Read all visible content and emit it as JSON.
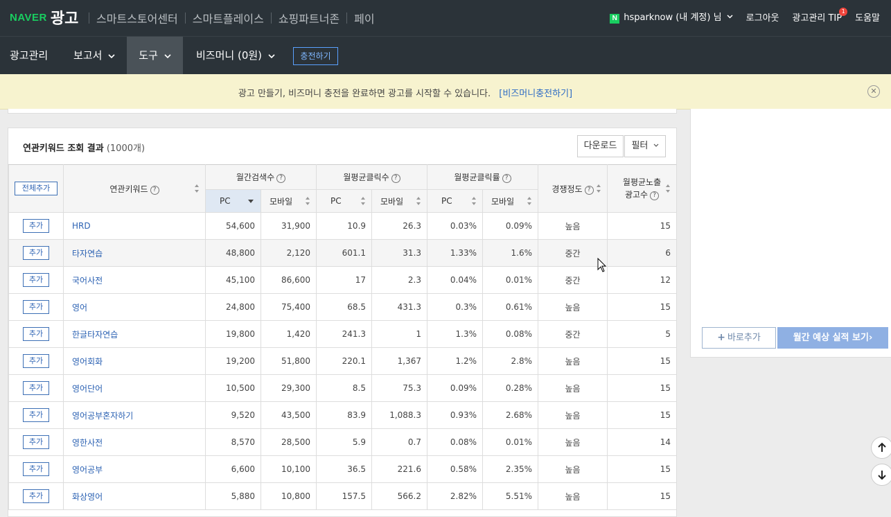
{
  "header": {
    "logo_naver": "NAVER",
    "logo_ad": "광고",
    "nav": [
      "스마트스토어센터",
      "스마트플레이스",
      "쇼핑파트너존",
      "페이"
    ],
    "user": "hsparknow (내 계정) 님",
    "logout": "로그아웃",
    "tip": "광고관리 TIP",
    "tip_badge": "1",
    "help": "도움말",
    "n_badge": "N"
  },
  "mainnav": {
    "items": [
      "광고관리",
      "보고서",
      "도구",
      "비즈머니 (0원)"
    ],
    "charge": "충전하기"
  },
  "notice": {
    "message": "광고 만들기, 비즈머니 충전을 완료하면 광고를 시작할 수 있습니다.",
    "link": "[비즈머니충전하기]"
  },
  "results": {
    "title": "연관키워드 조회 결과",
    "count": "(1000개)",
    "download": "다운로드",
    "filter": "필터"
  },
  "table": {
    "add_all": "전체추가",
    "col_keyword": "연관키워드",
    "col_search": "월간검색수",
    "col_clicks": "월평균클릭수",
    "col_ctr": "월평균클릭률",
    "col_comp": "경쟁정도",
    "col_ads_line1": "월평균노출",
    "col_ads_line2": "광고수",
    "pc": "PC",
    "mobile": "모바일",
    "add": "추가",
    "rows": [
      [
        "HRD",
        "54,600",
        "31,900",
        "10.9",
        "26.3",
        "0.03%",
        "0.09%",
        "높음",
        "15"
      ],
      [
        "타자연습",
        "48,800",
        "2,120",
        "601.1",
        "31.3",
        "1.33%",
        "1.6%",
        "중간",
        "6"
      ],
      [
        "국어사전",
        "45,100",
        "86,600",
        "17",
        "2.3",
        "0.04%",
        "0.01%",
        "중간",
        "12"
      ],
      [
        "영어",
        "24,800",
        "75,400",
        "68.5",
        "431.3",
        "0.3%",
        "0.61%",
        "높음",
        "15"
      ],
      [
        "한글타자연습",
        "19,800",
        "1,420",
        "241.3",
        "1",
        "1.3%",
        "0.08%",
        "중간",
        "5"
      ],
      [
        "영어회화",
        "19,200",
        "51,800",
        "220.1",
        "1,367",
        "1.2%",
        "2.8%",
        "높음",
        "15"
      ],
      [
        "영어단어",
        "10,500",
        "29,300",
        "8.5",
        "75.3",
        "0.09%",
        "0.28%",
        "높음",
        "15"
      ],
      [
        "영어공부혼자하기",
        "9,520",
        "43,500",
        "83.9",
        "1,088.3",
        "0.93%",
        "2.68%",
        "높음",
        "15"
      ],
      [
        "영한사전",
        "8,570",
        "28,500",
        "5.9",
        "0.7",
        "0.08%",
        "0.01%",
        "높음",
        "14"
      ],
      [
        "영어공부",
        "6,600",
        "10,100",
        "36.5",
        "221.6",
        "0.58%",
        "2.35%",
        "높음",
        "15"
      ],
      [
        "화상영어",
        "5,880",
        "10,800",
        "157.5",
        "566.2",
        "2.82%",
        "5.51%",
        "높음",
        "15"
      ]
    ]
  },
  "side": {
    "add_now": "바로추가",
    "forecast": "월간 예상 실적 보기›"
  }
}
